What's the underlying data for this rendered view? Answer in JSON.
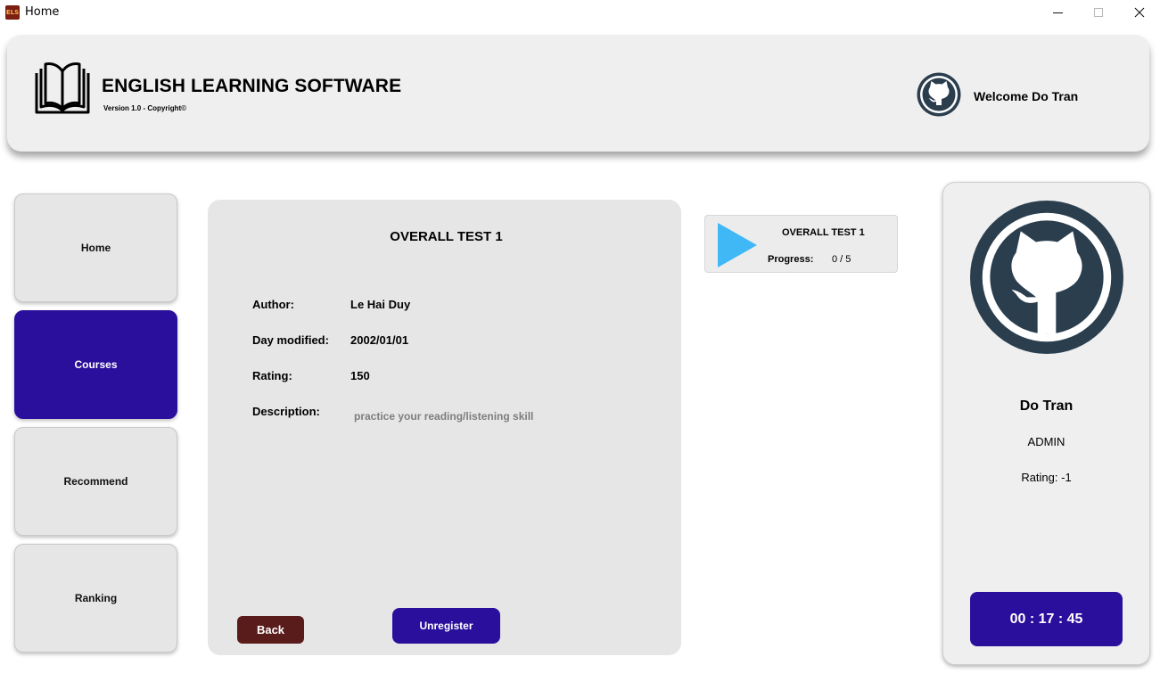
{
  "window": {
    "app_icon_text": "ELS",
    "title": "Home"
  },
  "header": {
    "app_name": "ENGLISH LEARNING SOFTWARE",
    "version": "Version 1.0 - Copyright©",
    "welcome": "Welcome Do Tran",
    "avatar_icon": "github-octocat-icon"
  },
  "sidebar": {
    "items": [
      {
        "label": "Home",
        "active": false
      },
      {
        "label": "Courses",
        "active": true
      },
      {
        "label": "Recommend",
        "active": false
      },
      {
        "label": "Ranking",
        "active": false
      }
    ]
  },
  "course": {
    "title": "OVERALL TEST 1",
    "fields": [
      {
        "label": "Author:",
        "value": "Le Hai Duy"
      },
      {
        "label": "Day modified:",
        "value": "2002/01/01"
      },
      {
        "label": "Rating:",
        "value": "150"
      },
      {
        "label": "Description:",
        "value": "practice your reading/listening skill"
      }
    ],
    "back_label": "Back",
    "unregister_label": "Unregister"
  },
  "progress_card": {
    "title": "OVERALL TEST 1",
    "progress_label": "Progress:",
    "progress_value": "0 / 5",
    "icon": "play-icon"
  },
  "profile": {
    "name": "Do Tran",
    "role": "ADMIN",
    "rating": "Rating: -1",
    "timer": "00 : 17 : 45"
  },
  "colors": {
    "accent": "#2a0f9c",
    "back_button": "#5a1b1b",
    "play": "#3fb8f5",
    "avatar": "#2b3e4e"
  }
}
